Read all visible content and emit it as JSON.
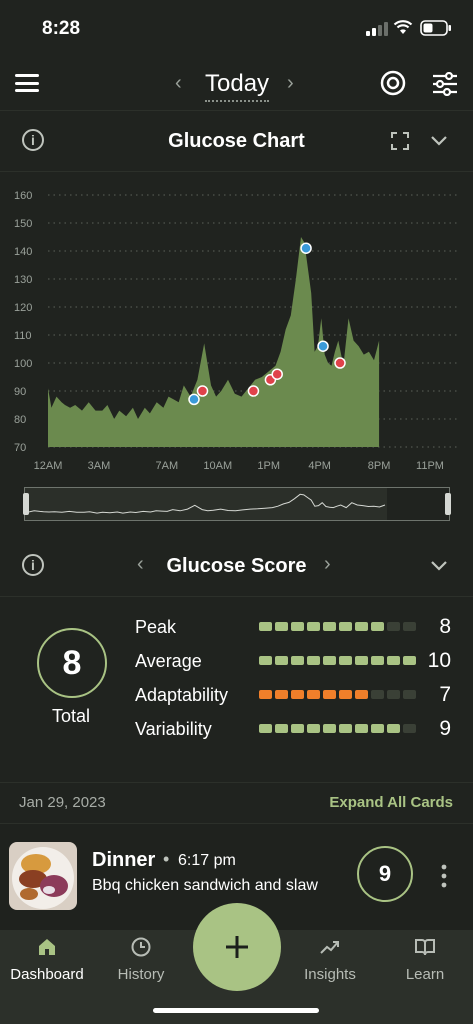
{
  "status": {
    "time": "8:28"
  },
  "header": {
    "title": "Today"
  },
  "glucose_chart": {
    "title": "Glucose Chart"
  },
  "chart_data": {
    "type": "area",
    "ylim": [
      70,
      160
    ],
    "yticks": [
      160,
      150,
      140,
      130,
      120,
      110,
      100,
      90,
      80,
      70
    ],
    "xticks": [
      "12AM",
      "3AM",
      "7AM",
      "10AM",
      "1PM",
      "4PM",
      "8PM",
      "11PM"
    ],
    "xtick_hours": [
      0,
      3,
      7,
      10,
      13,
      16,
      19.5,
      22.5
    ],
    "x_hours": [
      0,
      0.2,
      0.5,
      0.8,
      1,
      1.3,
      1.6,
      2,
      2.4,
      2.8,
      3.2,
      3.5,
      3.9,
      4.2,
      4.6,
      5,
      5.3,
      5.7,
      6,
      6.4,
      6.8,
      7.1,
      7.4,
      7.7,
      8,
      8.4,
      8.8,
      9.2,
      9.6,
      9.9,
      10.2,
      10.6,
      11,
      11.4,
      11.8,
      12.2,
      12.6,
      13,
      13.4,
      13.7,
      14,
      14.3,
      14.6,
      14.9,
      15.1,
      15.3,
      15.5,
      15.7,
      15.9,
      16.1,
      16.3,
      16.5,
      16.7,
      16.9,
      17.1,
      17.4,
      17.7,
      18,
      18.3,
      18.6,
      18.9,
      19.2,
      19.5
    ],
    "glucose": [
      91,
      84,
      88,
      86,
      85,
      84,
      85,
      83,
      86,
      83,
      83,
      85,
      80,
      83,
      81,
      84,
      80,
      84,
      82,
      86,
      84,
      88,
      87,
      86,
      92,
      88,
      94,
      107,
      92,
      88,
      90,
      94,
      89,
      88,
      91,
      94,
      95,
      97,
      99,
      104,
      112,
      117,
      130,
      145,
      143,
      134,
      125,
      104,
      106,
      116,
      103,
      100,
      99,
      104,
      108,
      99,
      116,
      108,
      106,
      103,
      104,
      101,
      108
    ],
    "events": [
      {
        "hour": 8.6,
        "value": 87,
        "color": "#3a9ad9"
      },
      {
        "hour": 9.1,
        "value": 90,
        "color": "#e0424b"
      },
      {
        "hour": 12.1,
        "value": 90,
        "color": "#e0424b"
      },
      {
        "hour": 13.1,
        "value": 94,
        "color": "#e0424b"
      },
      {
        "hour": 13.5,
        "value": 96,
        "color": "#e0424b"
      },
      {
        "hour": 15.2,
        "value": 141,
        "color": "#3a9ad9"
      },
      {
        "hour": 16.2,
        "value": 106,
        "color": "#3a9ad9"
      },
      {
        "hour": 17.2,
        "value": 100,
        "color": "#e0424b"
      }
    ],
    "area_color": "#6b8a4e",
    "grid": true
  },
  "glucose_score": {
    "title": "Glucose Score",
    "total": "8",
    "total_label": "Total",
    "metrics": [
      {
        "name": "Peak",
        "value": "8",
        "filled": 8,
        "color": "#a9c384"
      },
      {
        "name": "Average",
        "value": "10",
        "filled": 10,
        "color": "#a9c384"
      },
      {
        "name": "Adaptability",
        "value": "7",
        "filled": 7,
        "color": "#f07f2a"
      },
      {
        "name": "Variability",
        "value": "9",
        "filled": 9,
        "color": "#a9c384"
      }
    ]
  },
  "feed": {
    "date": "Jan 29, 2023",
    "expand_all": "Expand All Cards",
    "meal": {
      "type": "Dinner",
      "dot": "•",
      "time": "6:17 pm",
      "description": "Bbq chicken sandwich and slaw",
      "score": "9"
    }
  },
  "tabs": {
    "dashboard": "Dashboard",
    "history": "History",
    "insights": "Insights",
    "learn": "Learn",
    "add": "+"
  },
  "colors": {
    "accent": "#a9c384",
    "background": "#20231f",
    "tabbar": "#2c302a"
  }
}
